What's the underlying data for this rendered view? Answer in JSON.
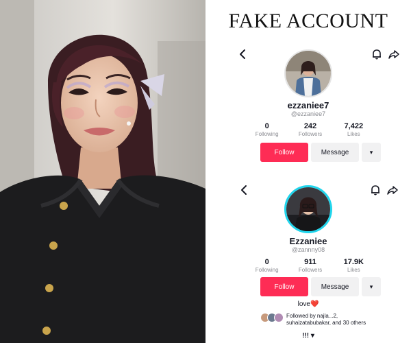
{
  "page": {
    "headline": "FAKE ACCOUNT"
  },
  "photo": {
    "icon": "portrait-photo"
  },
  "fake_profile": {
    "display_name": "ezzaniee7",
    "handle": "@ezzaniee7",
    "stats": [
      {
        "value": "0",
        "label": "Following"
      },
      {
        "value": "242",
        "label": "Followers"
      },
      {
        "value": "7,422",
        "label": "Likes"
      }
    ],
    "follow_label": "Follow",
    "message_label": "Message",
    "more_label": "▾"
  },
  "real_profile": {
    "display_name": "Ezzaniee",
    "handle": "@zannny08",
    "stats": [
      {
        "value": "0",
        "label": "Following"
      },
      {
        "value": "911",
        "label": "Followers"
      },
      {
        "value": "17.9K",
        "label": "Likes"
      }
    ],
    "follow_label": "Follow",
    "message_label": "Message",
    "more_label": "▾",
    "bio": "love❤️",
    "followed_by_line1": "Followed by najla...2,",
    "followed_by_line2": "suhaizatabubakar, and 30 others",
    "bottom_text": "!!! ▾"
  },
  "colors": {
    "follow_button": "#fe2c55",
    "secondary_button": "#f1f1f2",
    "muted_text": "#8a8b91",
    "story_ring": "#20d5ec"
  }
}
